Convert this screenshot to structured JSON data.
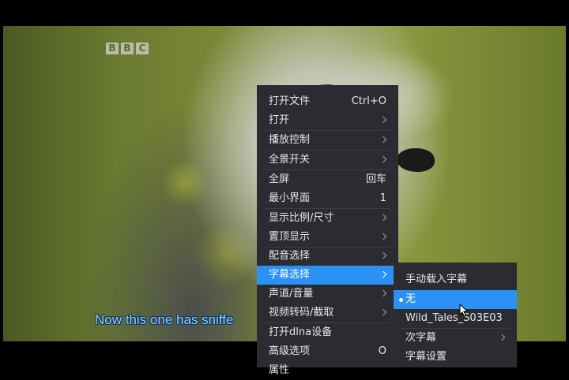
{
  "video": {
    "logo_letters": [
      "B",
      "B",
      "C"
    ],
    "subtitle": "Now this one has sniffe"
  },
  "main_menu": {
    "items": [
      {
        "label": "打开文件",
        "shortcut": "Ctrl+O",
        "submenu": false
      },
      {
        "label": "打开",
        "shortcut": "",
        "submenu": true
      },
      {
        "label": "播放控制",
        "shortcut": "",
        "submenu": true
      },
      {
        "label": "全景开关",
        "shortcut": "",
        "submenu": true
      },
      {
        "label": "全屏",
        "shortcut": "回车",
        "submenu": false
      },
      {
        "label": "最小界面",
        "shortcut": "1",
        "submenu": false
      },
      {
        "label": "显示比例/尺寸",
        "shortcut": "",
        "submenu": true
      },
      {
        "label": "置顶显示",
        "shortcut": "",
        "submenu": true
      },
      {
        "label": "配音选择",
        "shortcut": "",
        "submenu": true
      },
      {
        "label": "字幕选择",
        "shortcut": "",
        "submenu": true,
        "active": true
      },
      {
        "label": "声道/音量",
        "shortcut": "",
        "submenu": true
      },
      {
        "label": "视频转码/截取",
        "shortcut": "",
        "submenu": true
      },
      {
        "label": "打开dlna设备",
        "shortcut": "",
        "submenu": false
      },
      {
        "label": "高级选项",
        "shortcut": "O",
        "submenu": false
      },
      {
        "label": "属性",
        "shortcut": "",
        "submenu": false
      }
    ]
  },
  "subtitle_menu": {
    "items": [
      {
        "label": "手动载入字幕",
        "submenu": false
      },
      {
        "label": "无",
        "submenu": false,
        "checked": true,
        "active": true
      },
      {
        "label": "Wild_Tales_S03E03",
        "submenu": false
      },
      {
        "label": "次字幕",
        "submenu": true
      },
      {
        "label": "字幕设置",
        "submenu": false
      }
    ]
  },
  "colors": {
    "menu_bg": "#2b2c31",
    "highlight": "#2b91f5",
    "subtitle_text": "#8fd0ff"
  }
}
